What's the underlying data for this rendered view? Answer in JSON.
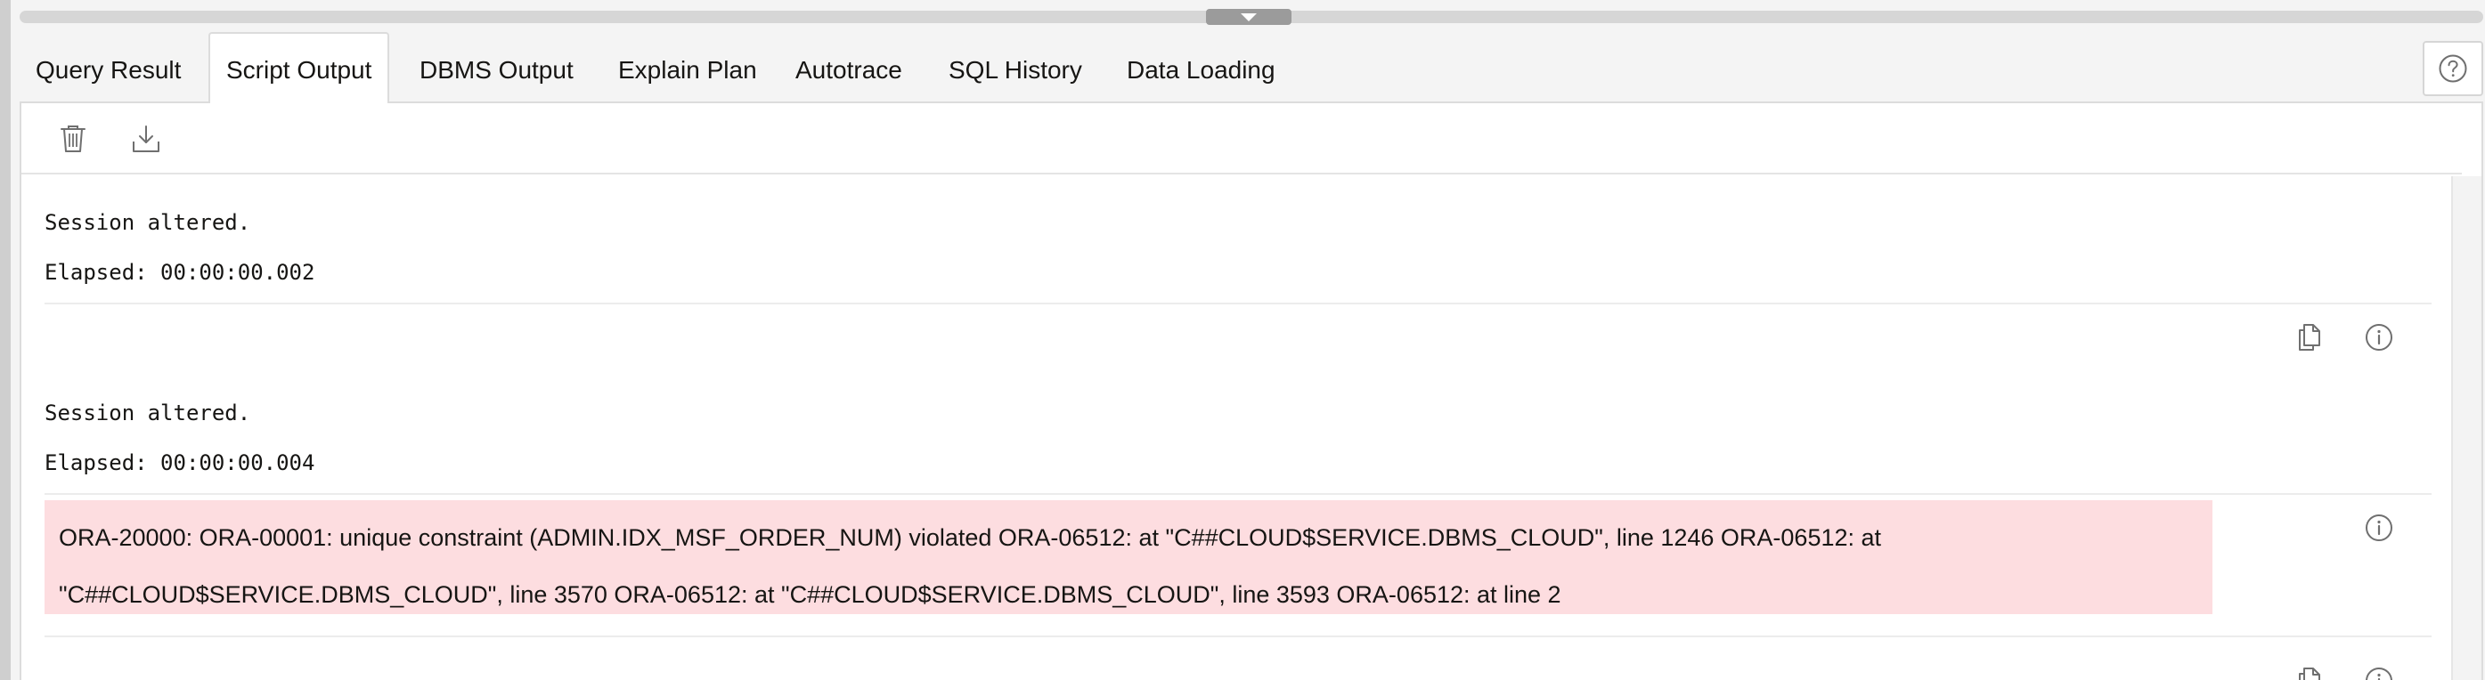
{
  "tabs": [
    {
      "label": "Query Result"
    },
    {
      "label": "Script Output"
    },
    {
      "label": "DBMS Output"
    },
    {
      "label": "Explain Plan"
    },
    {
      "label": "Autotrace"
    },
    {
      "label": "SQL History"
    },
    {
      "label": "Data Loading"
    }
  ],
  "active_tab": "Script Output",
  "toolbar": {
    "clear_icon": "trash-icon",
    "download_icon": "download-icon"
  },
  "output": {
    "block1": {
      "message": "Session altered.",
      "elapsed": "Elapsed: 00:00:00.002"
    },
    "block2": {
      "message": "Session altered.",
      "elapsed": "Elapsed: 00:00:00.004"
    },
    "error": {
      "line1": "ORA-20000: ORA-00001: unique constraint (ADMIN.IDX_MSF_ORDER_NUM) violated ORA-06512: at \"C##CLOUD$SERVICE.DBMS_CLOUD\", line 1246 ORA-06512: at",
      "line2": "\"C##CLOUD$SERVICE.DBMS_CLOUD\", line 3570 ORA-06512: at \"C##CLOUD$SERVICE.DBMS_CLOUD\", line 3593 ORA-06512: at line 2"
    }
  },
  "colors": {
    "error_bg": "#fddde0",
    "active_tab_bg": "#ffffff",
    "icon": "#6f6f6f"
  }
}
